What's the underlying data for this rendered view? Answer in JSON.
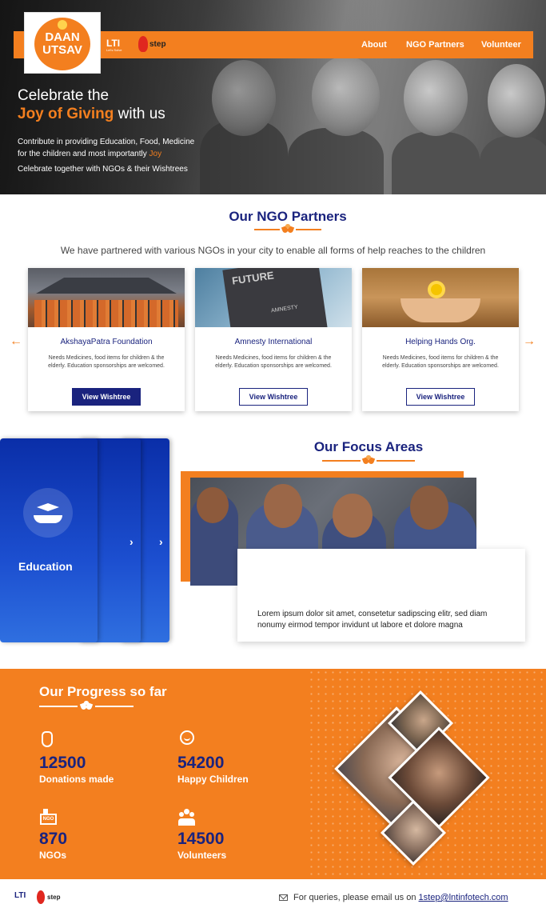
{
  "brand": {
    "logo_line1": "DAAN",
    "logo_line2": "UTSAV",
    "lti": "LTI",
    "lti_sub": "Let's Solve",
    "onestep": "step"
  },
  "nav": {
    "about": "About",
    "ngo_partners": "NGO Partners",
    "volunteer": "Volunteer"
  },
  "hero": {
    "title_line1": "Celebrate the",
    "title_accent": "Joy of Giving",
    "title_rest": " with us",
    "line1": "Contribute in providing Education, Food, Medicine",
    "line2": "for the children and most importantly ",
    "line2_accent": "Joy",
    "line3": "Celebrate together with NGOs & their Wishtrees"
  },
  "partners": {
    "title": "Our NGO Partners",
    "intro": "We have partnered with various NGOs in your city to enable all forms of help reaches to the children",
    "cards": [
      {
        "name": "AkshayaPatra Foundation",
        "desc": "Needs Medicines, food items for children & the elderly. Education sponsorships are welcomed.",
        "button": "View Wishtree"
      },
      {
        "name": "Amnesty International",
        "desc": "Needs Medicines, food items for children & the elderly. Education sponsorships are welcomed.",
        "button": "View Wishtree",
        "image_text1": "FUTURE",
        "image_text2": "AMNESTY"
      },
      {
        "name": "Helping Hands Org.",
        "desc": "Needs Medicines, food items for children & the elderly. Education sponsorships are welcomed.",
        "button": "View Wishtree"
      }
    ],
    "prev_arrow": "←",
    "next_arrow": "→"
  },
  "focus": {
    "title": "Our Focus Areas",
    "active_area": "Education",
    "chevron": "›",
    "description": "Lorem ipsum dolor sit amet, consetetur sadipscing elitr, sed diam nonumy eirmod tempor invidunt ut labore et dolore magna"
  },
  "progress": {
    "title": "Our Progress so far",
    "stats": [
      {
        "value": "12500",
        "label": "Donations made",
        "icon": "hand-icon"
      },
      {
        "value": "54200",
        "label": "Happy Children",
        "icon": "happy-child-icon"
      },
      {
        "value": "870",
        "label": "NGOs",
        "icon": "ngo-icon"
      },
      {
        "value": "14500",
        "label": "Volunteers",
        "icon": "volunteers-icon"
      }
    ],
    "ngo_icon_text": "NGO"
  },
  "footer": {
    "lti": "LTI",
    "onestep": "step",
    "query_text": "For queries, please email us on ",
    "email": "1step@lntinfotech.com"
  },
  "colors": {
    "accent": "#f37f1f",
    "navy": "#1a237e",
    "focus_blue": "#0a2ea8"
  }
}
